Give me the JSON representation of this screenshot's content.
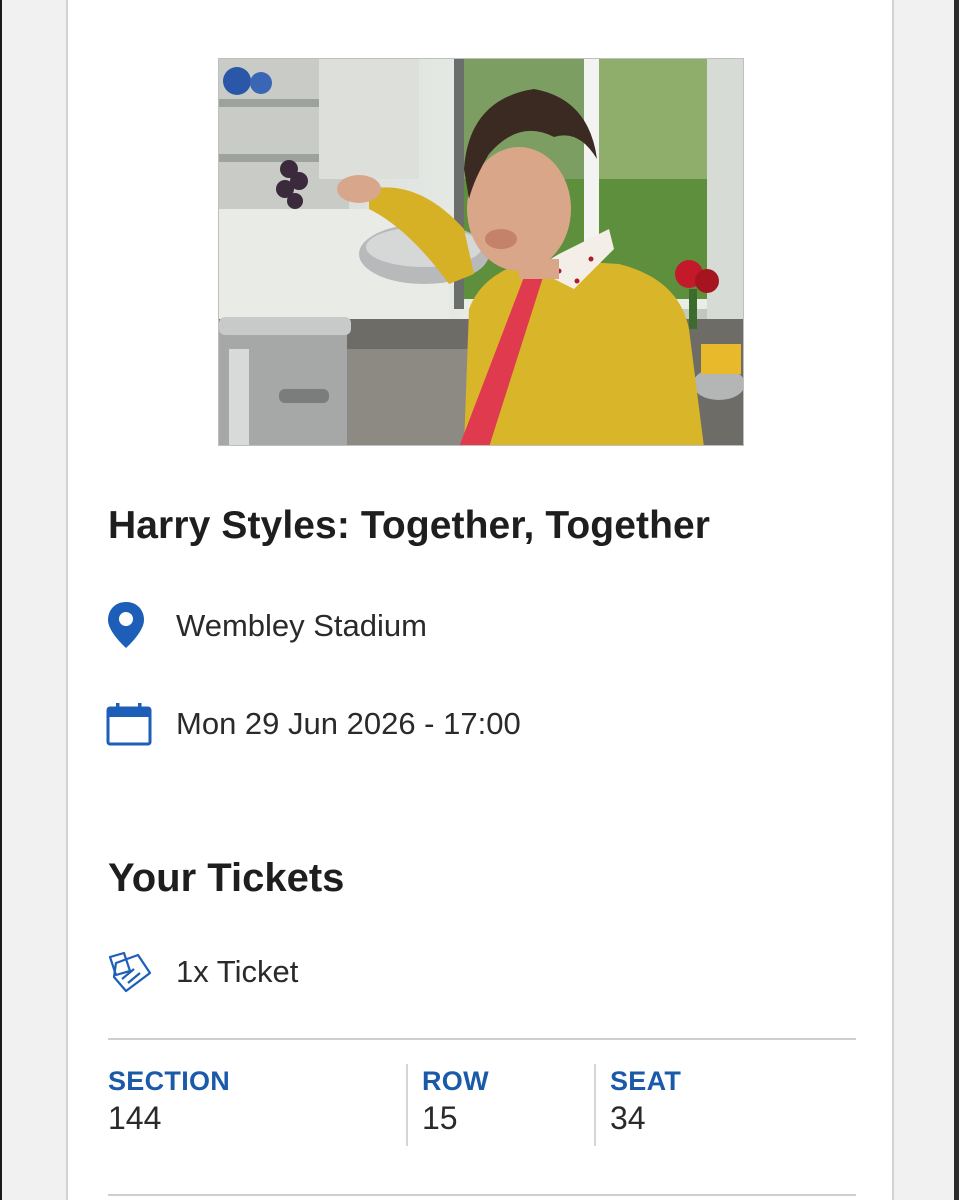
{
  "event": {
    "title": "Harry Styles: Together, Together",
    "venue": "Wembley Stadium",
    "datetime": "Mon 29 Jun 2026 - 17:00",
    "venue_icon": "location-pin-icon",
    "date_icon": "calendar-icon"
  },
  "tickets": {
    "heading": "Your Tickets",
    "count_label": "1x Ticket",
    "count_icon": "tickets-icon",
    "seat": {
      "section_label": "SECTION",
      "section_value": "144",
      "row_label": "ROW",
      "row_value": "15",
      "seat_label": "SEAT",
      "seat_value": "34"
    }
  },
  "colors": {
    "accent_blue": "#1a5aa8",
    "icon_blue": "#1d5fb8",
    "text": "#1e1e1e"
  }
}
